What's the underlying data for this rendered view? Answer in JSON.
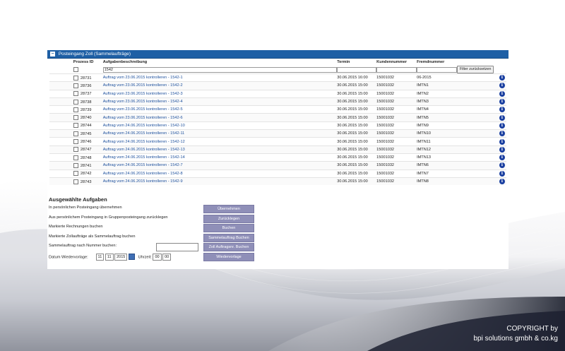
{
  "panel": {
    "title": "Posteingang Zoll (Sammelaufträge)",
    "columns": {
      "prozess_id": "Prozess ID",
      "aufgabe": "Aufgabenbeschreibung",
      "termin": "Termin",
      "kunde": "Kundennummer",
      "fremd": "Fremdnummer"
    },
    "filter": {
      "aufgabe_value": "1542",
      "fremd_value": "",
      "reset_label": "Filter zurücksetzen"
    },
    "rows": [
      {
        "id": "28731",
        "desc": "Auftrag vom 23.06.2015 kontrolleren - 1542-1",
        "termin": "30.06.2015 16:00",
        "kunde": "15001032",
        "fremd": "06-2015"
      },
      {
        "id": "28736",
        "desc": "Auftrag vom 23.06.2015 kontrolleren - 1542-2",
        "termin": "30.06.2015 15:00",
        "kunde": "15001032",
        "fremd": "IMTN1"
      },
      {
        "id": "28737",
        "desc": "Auftrag vom 23.06.2015 kontrolleren - 1542-3",
        "termin": "30.06.2015 15:00",
        "kunde": "15001032",
        "fremd": "IMTN2"
      },
      {
        "id": "28738",
        "desc": "Auftrag vom 23.06.2015 kontrolleren - 1542-4",
        "termin": "30.06.2015 15:00",
        "kunde": "15001032",
        "fremd": "IMTN3"
      },
      {
        "id": "28739",
        "desc": "Auftrag vom 23.06.2015 kontrolleren - 1542-5",
        "termin": "30.06.2015 15:00",
        "kunde": "15001032",
        "fremd": "IMTN4"
      },
      {
        "id": "28740",
        "desc": "Auftrag vom 23.06.2015 kontrolleren - 1542-6",
        "termin": "30.06.2015 15:00",
        "kunde": "15001032",
        "fremd": "IMTN5"
      },
      {
        "id": "28744",
        "desc": "Auftrag vom 24.06.2015 kontrolleren - 1542-10",
        "termin": "30.06.2015 15:00",
        "kunde": "15001032",
        "fremd": "IMTN9"
      },
      {
        "id": "28745",
        "desc": "Auftrag vom 24.06.2015 kontrolleren - 1542-11",
        "termin": "30.06.2015 15:00",
        "kunde": "15001032",
        "fremd": "IMTN10"
      },
      {
        "id": "28746",
        "desc": "Auftrag vom 24.06.2015 kontrolleren - 1542-12",
        "termin": "30.06.2015 15:00",
        "kunde": "15001032",
        "fremd": "IMTN11"
      },
      {
        "id": "28747",
        "desc": "Auftrag vom 24.06.2015 kontrolleren - 1542-13",
        "termin": "30.06.2015 15:00",
        "kunde": "15001032",
        "fremd": "IMTN12"
      },
      {
        "id": "28748",
        "desc": "Auftrag vom 24.06.2015 kontrolleren - 1542-14",
        "termin": "30.06.2015 15:00",
        "kunde": "15001032",
        "fremd": "IMTN13"
      },
      {
        "id": "28741",
        "desc": "Auftrag vom 24.06.2015 kontrolleren - 1542-7",
        "termin": "30.06.2015 15:00",
        "kunde": "15001032",
        "fremd": "IMTN6"
      },
      {
        "id": "28742",
        "desc": "Auftrag vom 24.06.2015 kontrolleren - 1542-8",
        "termin": "30.06.2015 15:00",
        "kunde": "15001032",
        "fremd": "IMTN7"
      },
      {
        "id": "28743",
        "desc": "Auftrag vom 24.06.2015 kontrolleren - 1542-9",
        "termin": "30.06.2015 15:00",
        "kunde": "15001032",
        "fremd": "IMTN8"
      }
    ]
  },
  "tasks": {
    "heading": "Ausgewählte Aufgaben",
    "items": [
      {
        "label": "In persönlichen Posteingang übernehmen",
        "button": "Übernehmen"
      },
      {
        "label": "Aus persönlichem Posteingang in Gruppenposteingang zurücklegen",
        "button": "Zurücklegen"
      },
      {
        "label": "Markierte Rechnungen buchen",
        "button": "Buchen"
      },
      {
        "label": "Markierte Zollaufträge als Sammelauftrag buchen",
        "button": "Sammelauftrag Buchen"
      },
      {
        "label": "Sammelauftrag nach Nummer buchen:",
        "button": "Zoll Auftragsnr. Buchen"
      }
    ],
    "wiedervorlage": {
      "label": "Datum Wiedervorlage:",
      "day": "11",
      "month": "11",
      "year": "2015",
      "time_label": "Uhrzeit:",
      "hour": "00",
      "minute": "00",
      "button": "Wiedervorlage"
    }
  },
  "footer": {
    "line1": "COPYRIGHT by",
    "line2": "bpi solutions gmbh & co.kg"
  },
  "colors": {
    "header_blue": "#1e5fa5",
    "button_purple": "#8f8fb8",
    "link_blue": "#1c4f9c"
  },
  "icons": {
    "info": "info-icon",
    "toggle": "collapse-icon",
    "calendar": "calendar-icon"
  }
}
